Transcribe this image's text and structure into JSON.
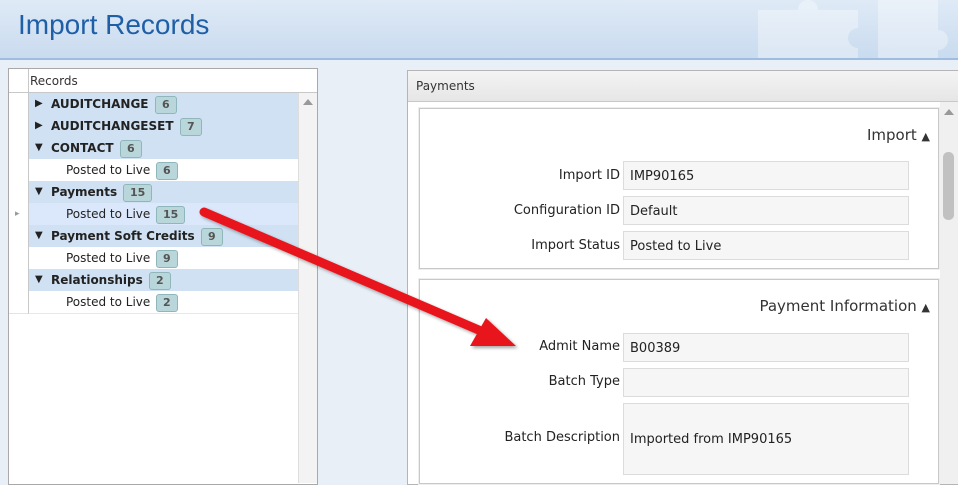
{
  "page_title": "Import Records",
  "records_panel": {
    "header": "Records",
    "rows": [
      {
        "type": "group",
        "expanded": false,
        "label": "AUDITCHANGE",
        "count": "6"
      },
      {
        "type": "group",
        "expanded": false,
        "label": "AUDITCHANGESET",
        "count": "7"
      },
      {
        "type": "group",
        "expanded": true,
        "label": "CONTACT",
        "count": "6"
      },
      {
        "type": "child",
        "label": "Posted to Live",
        "count": "6"
      },
      {
        "type": "group",
        "expanded": true,
        "label": "Payments",
        "count": "15"
      },
      {
        "type": "child",
        "label": "Posted to Live",
        "count": "15",
        "selected": true
      },
      {
        "type": "group",
        "expanded": true,
        "label": "Payment Soft Credits",
        "count": "9"
      },
      {
        "type": "child",
        "label": "Posted to Live",
        "count": "9"
      },
      {
        "type": "group",
        "expanded": true,
        "label": "Relationships",
        "count": "2"
      },
      {
        "type": "child",
        "label": "Posted to Live",
        "count": "2"
      }
    ]
  },
  "detail_panel": {
    "header": "Payments",
    "import_section": {
      "title": "Import",
      "fields": [
        {
          "label": "Import ID",
          "value": "IMP90165"
        },
        {
          "label": "Configuration ID",
          "value": "Default"
        },
        {
          "label": "Import Status",
          "value": "Posted to Live"
        }
      ]
    },
    "payment_section": {
      "title": "Payment Information",
      "fields": [
        {
          "label": "Admit Name",
          "value": "B00389"
        },
        {
          "label": "Batch Type",
          "value": ""
        },
        {
          "label": "Batch Description",
          "value": "Imported from IMP90165"
        }
      ]
    }
  },
  "icons": {
    "collapsed": "triangle-right-icon",
    "expanded": "triangle-down-icon",
    "section_toggle": "chevron-up-icon"
  },
  "colors": {
    "accent": "#1f5fa6",
    "group_band": "#cfe1f3",
    "badge": "#b9d7da",
    "arrow": "#e8141b"
  }
}
